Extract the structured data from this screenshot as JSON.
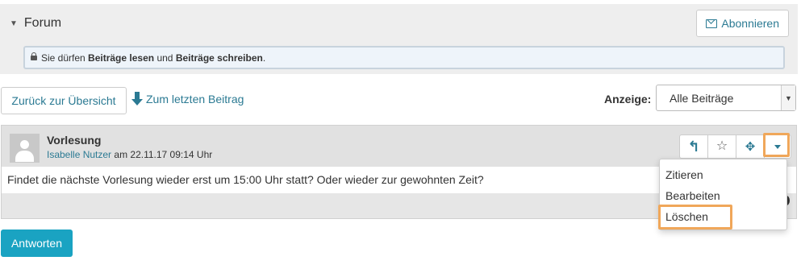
{
  "forum": {
    "title": "Forum",
    "subscribe_label": "Abonnieren",
    "permissions": {
      "prefix": "Sie dürfen",
      "read": "Beiträge lesen",
      "and": "und",
      "write": "Beiträge schreiben",
      "suffix": "."
    }
  },
  "toolbar": {
    "back_label": "Zurück zur Übersicht",
    "last_post_label": "Zum letzten Beitrag",
    "display_label": "Anzeige:",
    "display_selected": "Alle Beiträge"
  },
  "post": {
    "title": "Vorlesung",
    "author": "Isabelle Nutzer",
    "date_prefix": "am",
    "date": "22.11.17 09:14 Uhr",
    "body": "Findet die nächste Vorlesung wieder erst um 15:00 Uhr statt? Oder wieder zur gewohnten Zeit?"
  },
  "actions": {
    "icons": [
      "reply-icon",
      "star-icon",
      "puzzle-icon",
      "caret-down-icon"
    ],
    "menu": [
      "Zitieren",
      "Bearbeiten",
      "Löschen"
    ]
  },
  "answer_label": "Antworten",
  "colors": {
    "accent": "#2b7a93",
    "primary_button": "#1aa3c2",
    "highlight": "#f0a75a",
    "panel_bg": "#eeeeee",
    "info_bg": "#eef4fa"
  }
}
